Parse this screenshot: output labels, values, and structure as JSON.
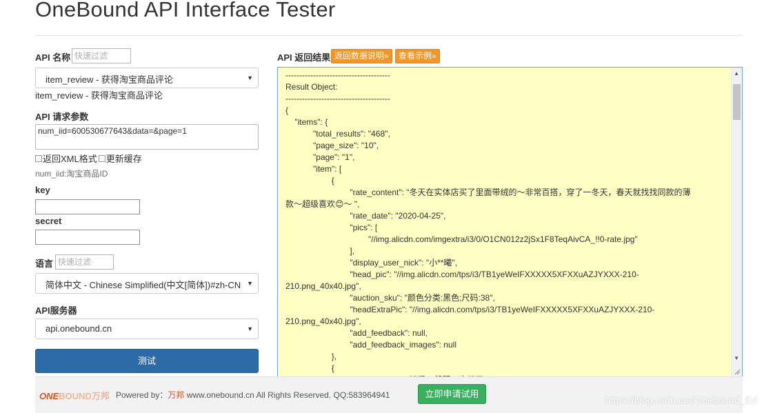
{
  "header": {
    "title": "OneBound API Interface Tester"
  },
  "left": {
    "api_name_label": "API 名称",
    "api_filter_placeholder": "快速过滤",
    "api_select_value": "item_review - 获得淘宝商品评论",
    "api_description": "item_review - 获得淘宝商品评论",
    "params_label": "API 请求参数",
    "params_value": "num_iid=600530677643&data=&page=1",
    "xml_checkbox_label": "返回XML格式",
    "cache_checkbox_label": "更新缓存",
    "param_hint": "num_iid:淘宝商品ID",
    "key_label": "key",
    "secret_label": "secret",
    "lang_label": "语言",
    "lang_filter_placeholder": "快速过滤",
    "lang_select_value": "简体中文 - Chinese Simplified(中文[简体])#zh-CN",
    "server_label": "API服务器",
    "server_select_value": "api.onebound.cn",
    "test_button": "测试"
  },
  "right": {
    "result_label": "API 返回结果",
    "doc_button": "返回数据说明»",
    "example_button": "查看示例»",
    "result_text": "--------------------------------------\nResult Object:\n--------------------------------------\n{\n\t\"items\": {\n\t\t\t\"total_results\": \"468\",\n\t\t\t\"page_size\": \"10\",\n\t\t\t\"page\": \"1\",\n\t\t\t\"item\": [\n\t\t\t\t\t{\n\t\t\t\t\t\t\t\"rate_content\": \"冬天在实体店买了里面带绒的～非常百搭，穿了一冬天，春天就找找同款的薄\n款～超级喜欢😊～ \",\n\t\t\t\t\t\t\t\"rate_date\": \"2020-04-25\",\n\t\t\t\t\t\t\t\"pics\": [\n\t\t\t\t\t\t\t\t\t\"//img.alicdn.com/imgextra/i3/0/O1CN012z2jSx1F8TeqAivCA_!!0-rate.jpg\"\n\t\t\t\t\t\t\t],\n\t\t\t\t\t\t\t\"display_user_nick\": \"小**曦\",\n\t\t\t\t\t\t\t\"head_pic\": \"//img.alicdn.com/tps/i3/TB1yeWeIFXXXXX5XFXXuAZJYXXX-210-\n210.png_40x40.jpg\",\n\t\t\t\t\t\t\t\"auction_sku\": \"颜色分类:黑色;尺码:38\",\n\t\t\t\t\t\t\t\"headExtraPic\": \"//img.alicdn.com/tps/i3/TB1yeWeIFXXXXX5XFXXuAZJYXXX-210-\n210.png_40x40.jpg\",\n\t\t\t\t\t\t\t\"add_feedback\": null,\n\t\t\t\t\t\t\t\"add_feedback_images\": null\n\t\t\t\t\t},\n\t\t\t\t\t{\n\t\t\t\t\t\t\t\"rate_content\": \"好看，舒服，太好了。\","
  },
  "footer": {
    "logo_one": "ONE",
    "logo_bound": "BOUND",
    "logo_cn": "万邦",
    "powered_prefix": "Powered by：",
    "powered_brand": "万邦",
    "powered_suffix": " www.onebound.cn All Rights Reserved. QQ:583964941",
    "apply_button": "立即申请试用"
  },
  "watermark": "https://blog.csdn.net/Onebound_Ed",
  "colors": {
    "primary_button": "#2d6ba6",
    "orange_button": "#f0962a",
    "apply_button": "#39b060",
    "result_background": "#ffffc3",
    "brand": "#e8501f"
  },
  "icons": {
    "select_caret": "caret-down-icon",
    "scroll_up": "scroll-up-arrow-icon",
    "scroll_down": "scroll-down-arrow-icon"
  }
}
